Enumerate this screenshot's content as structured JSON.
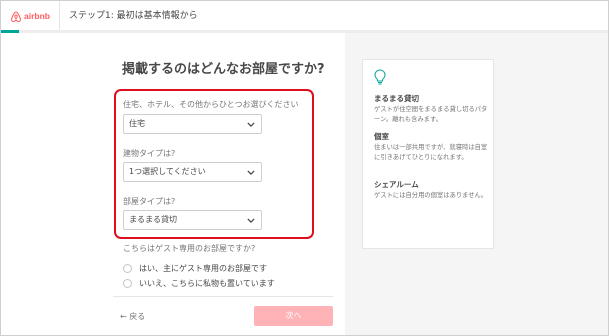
{
  "header": {
    "brand": "airbnb",
    "step_title": "ステップ1: 最初は基本情報から",
    "progress_fraction": 0.03,
    "accent_color": "#00a699",
    "brand_color": "#ff5a5f"
  },
  "main": {
    "title": "掲載するのはどんなお部屋ですか?",
    "fields": [
      {
        "label": "住宅、ホテル、その他からひとつお選びください",
        "value": "住宅"
      },
      {
        "label": "建物タイプは?",
        "value": "1つ選択してください"
      },
      {
        "label": "部屋タイプは?",
        "value": "まるまる貸切"
      }
    ],
    "guest_question": "こちらはゲスト専用のお部屋ですか?",
    "radio_options": [
      "はい、主にゲスト専用のお部屋です",
      "いいえ、こちらに私物も置いています"
    ],
    "back_label": "← 戻る",
    "next_label": "次へ",
    "highlight_color": "#e00d1f"
  },
  "tips": {
    "icon": "lightbulb-icon",
    "items": [
      {
        "title": "まるまる貸切",
        "body": "ゲストが住空間をまるまる貸し切るパターン。離れも含みます。"
      },
      {
        "title": "個室",
        "body": "住まいは一部共用ですが、就寝時は自室に引きあげてひとりになれます。"
      },
      {
        "title": "シェアルーム",
        "body": "ゲストには自分用の個室はありません。"
      }
    ]
  }
}
